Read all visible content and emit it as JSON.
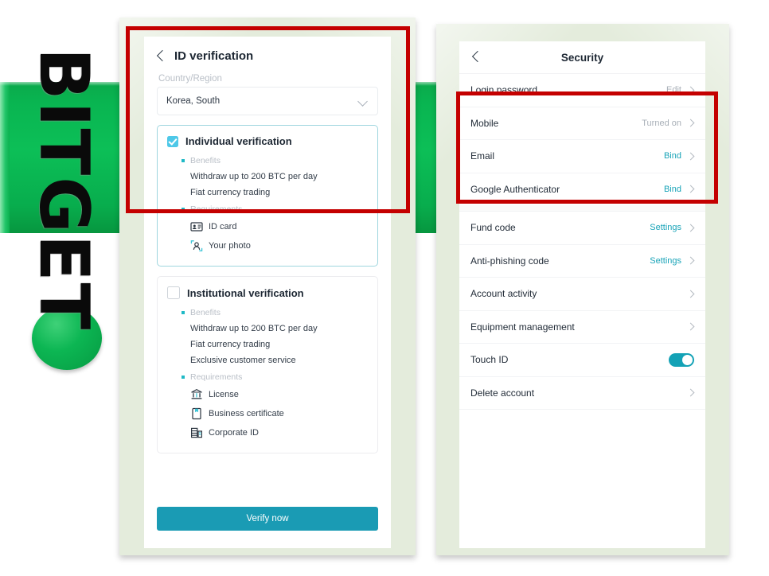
{
  "brand": {
    "wordmark": "BITGET",
    "band_color": "#0bb14f",
    "dot_color": "#0cb653"
  },
  "annotations": {
    "color": "#c40000",
    "boxes": [
      {
        "name": "id-verification-highlight"
      },
      {
        "name": "two-factor-highlight"
      }
    ]
  },
  "left_phone": {
    "nav": {
      "back_icon": "chevron-left-icon",
      "title": "ID verification"
    },
    "country_field": {
      "label": "Country/Region",
      "value": "Korea, South",
      "chevron_icon": "chevron-down-icon"
    },
    "individual_card": {
      "checked": true,
      "checkbox_color": "#4ec8e8",
      "title": "Individual verification",
      "benefits_heading": "Benefits",
      "benefits": [
        "Withdraw up to 200 BTC per day",
        "Fiat currency trading"
      ],
      "requirements_heading": "Requirements",
      "requirements": [
        {
          "label": "ID card",
          "icon": "id-card-icon"
        },
        {
          "label": "Your photo",
          "icon": "portrait-photo-icon"
        }
      ]
    },
    "institutional_card": {
      "checked": false,
      "title": "Institutional verification",
      "benefits_heading": "Benefits",
      "benefits": [
        "Withdraw up to 200 BTC per day",
        "Fiat currency trading",
        "Exclusive customer service"
      ],
      "requirements_heading": "Requirements",
      "requirements": [
        {
          "label": "License",
          "icon": "bank-license-icon"
        },
        {
          "label": "Business certificate",
          "icon": "certificate-icon"
        },
        {
          "label": "Corporate ID",
          "icon": "corporate-building-icon"
        }
      ]
    },
    "cta": {
      "label": "Verify now",
      "color": "#1a9bb4"
    }
  },
  "right_phone": {
    "nav": {
      "back_icon": "chevron-left-icon",
      "title": "Security"
    },
    "rows": [
      {
        "label": "Login password",
        "value": "Edit",
        "value_style": "gray",
        "control": "chevron"
      },
      {
        "label": "Mobile",
        "value": "Turned on",
        "value_style": "gray",
        "control": "chevron"
      },
      {
        "label": "Email",
        "value": "Bind",
        "value_style": "teal",
        "control": "chevron"
      },
      {
        "label": "Google Authenticator",
        "value": "Bind",
        "value_style": "teal",
        "control": "chevron"
      },
      {
        "label": "Fund code",
        "value": "Settings",
        "value_style": "teal",
        "control": "chevron"
      },
      {
        "label": "Anti-phishing code",
        "value": "Settings",
        "value_style": "teal",
        "control": "chevron"
      },
      {
        "label": "Account activity",
        "value": "",
        "value_style": "gray",
        "control": "chevron"
      },
      {
        "label": "Equipment management",
        "value": "",
        "value_style": "gray",
        "control": "chevron"
      },
      {
        "label": "Touch ID",
        "value": "",
        "value_style": "gray",
        "control": "toggle-on"
      },
      {
        "label": "Delete account",
        "value": "",
        "value_style": "gray",
        "control": "chevron"
      }
    ],
    "toggle_color": "#14a2b6",
    "teal_accent": "#1aa4b8"
  }
}
